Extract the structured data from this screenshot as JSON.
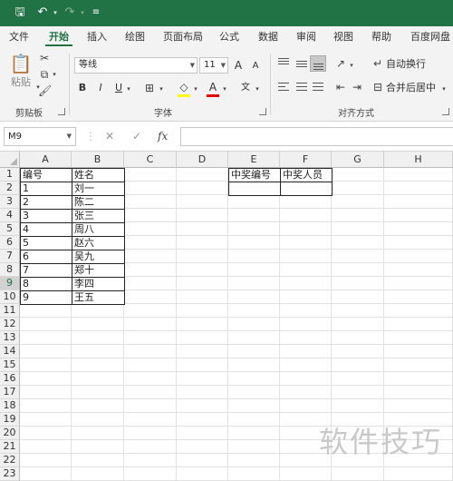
{
  "quick_access": {
    "save": "🖫",
    "undo": "↶",
    "redo": "↷",
    "customize": "≡"
  },
  "tabs": [
    "文件",
    "开始",
    "插入",
    "绘图",
    "页面布局",
    "公式",
    "数据",
    "审阅",
    "视图",
    "帮助",
    "百度网盘"
  ],
  "active_tab": "开始",
  "ribbon": {
    "clipboard": {
      "paste": "粘贴",
      "group": "剪贴板"
    },
    "font": {
      "name": "等线",
      "size": "11",
      "grow": "A",
      "shrink": "A",
      "bold": "B",
      "italic": "I",
      "underline": "U",
      "font_color": "A",
      "phonetic": "文",
      "group": "字体"
    },
    "alignment": {
      "wrap_text": "自动换行",
      "merge_center": "合并后居中",
      "group": "对齐方式"
    }
  },
  "formula_bar": {
    "name_box": "M9",
    "cancel": "✕",
    "enter": "✓",
    "fx": "fx",
    "value": ""
  },
  "columns": [
    "A",
    "B",
    "C",
    "D",
    "E",
    "F",
    "G",
    "H"
  ],
  "rows": [
    "1",
    "2",
    "3",
    "4",
    "5",
    "6",
    "7",
    "8",
    "9",
    "10",
    "11",
    "12",
    "13",
    "14",
    "15",
    "16",
    "17",
    "18",
    "19",
    "20",
    "21",
    "22",
    "23"
  ],
  "selected_row": "9",
  "table_a": [
    [
      "编号",
      "姓名"
    ],
    [
      "1",
      "刘一"
    ],
    [
      "2",
      "陈二"
    ],
    [
      "3",
      "张三"
    ],
    [
      "4",
      "周八"
    ],
    [
      "5",
      "赵六"
    ],
    [
      "6",
      "吴九"
    ],
    [
      "7",
      "郑十"
    ],
    [
      "8",
      "李四"
    ],
    [
      "9",
      "王五"
    ]
  ],
  "table_b": {
    "headers": [
      "中奖编号",
      "中奖人员"
    ],
    "values": [
      "",
      ""
    ]
  },
  "watermark": "软件技巧"
}
